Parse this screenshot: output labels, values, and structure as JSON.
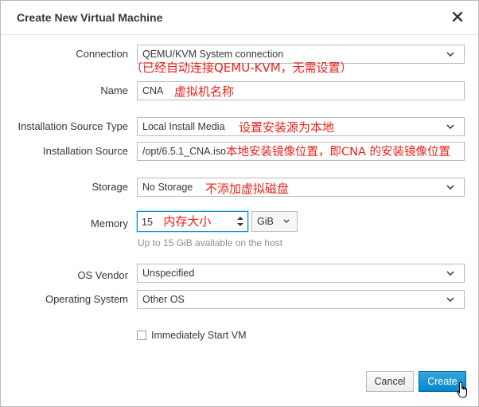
{
  "dialog": {
    "title": "Create New Virtual Machine",
    "close_icon": "close-icon"
  },
  "form": {
    "connection": {
      "label": "Connection",
      "value": "QEMU/KVM System connection",
      "note": "（已经自动连接QEMU-KVM，无需设置）"
    },
    "name": {
      "label": "Name",
      "value": "CNA",
      "note": "虚拟机名称"
    },
    "install_type": {
      "label": "Installation Source Type",
      "value": "Local Install Media",
      "note": "设置安装源为本地"
    },
    "install_source": {
      "label": "Installation Source",
      "value": "/opt/6.5.1_CNA.iso",
      "note": "本地安装镜像位置，即CNA 的安装镜像位置"
    },
    "storage": {
      "label": "Storage",
      "value": "No Storage",
      "note": "不添加虚拟磁盘"
    },
    "memory": {
      "label": "Memory",
      "value": "15",
      "note": "内存大小",
      "unit": "GiB",
      "helper": "Up to 15 GiB available on the host"
    },
    "os_vendor": {
      "label": "OS Vendor",
      "value": "Unspecified"
    },
    "os": {
      "label": "Operating System",
      "value": "Other OS"
    },
    "start_vm": {
      "label": "Immediately Start VM",
      "checked": false
    }
  },
  "footer": {
    "cancel_label": "Cancel",
    "create_label": "Create"
  },
  "colors": {
    "annotation": "#e8231a",
    "primary": "#0088ce",
    "border": "#bababa"
  }
}
